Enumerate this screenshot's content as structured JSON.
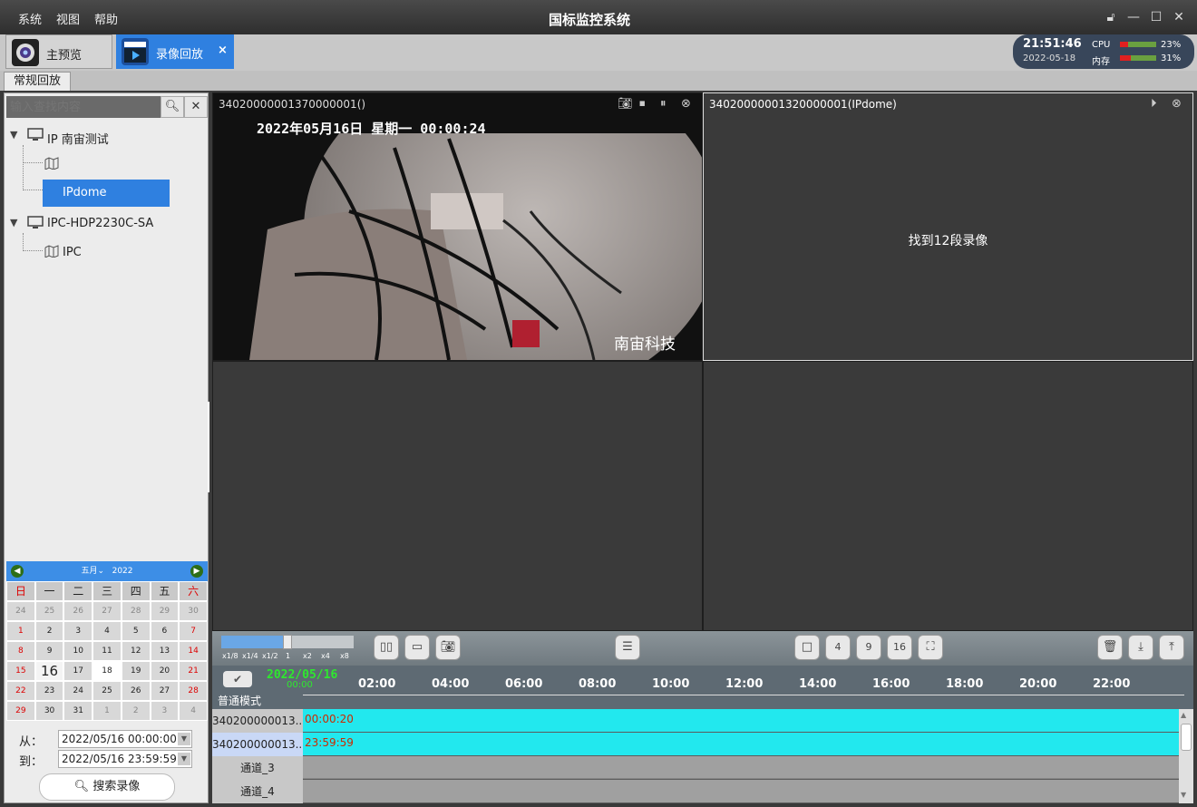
{
  "menu": [
    "系统",
    "视图",
    "帮助"
  ],
  "app_title": "国标监控系统",
  "app_tabs": [
    {
      "label": "主预览"
    },
    {
      "label": "录像回放",
      "close": "×"
    }
  ],
  "sysinfo": {
    "time": "21:51:46",
    "date": "2022-05-18",
    "cpu_label": "CPU",
    "cpu_value": "23%",
    "cpu_level": 0.23,
    "mem_label": "内存",
    "mem_value": "31%",
    "mem_level": 0.31
  },
  "subtab": "常规回放",
  "search": {
    "placeholder": "输入查找内容"
  },
  "tree": {
    "group1": "IP 南宙测试",
    "item1a": "",
    "item1b": "IPdome",
    "group2": "IPC-HDP2230C-SA",
    "item2a": "IPC"
  },
  "calendar": {
    "month": "五月",
    "year": "2022",
    "weekdays": [
      "日",
      "一",
      "二",
      "三",
      "四",
      "五",
      "六"
    ],
    "days": [
      "24",
      "25",
      "26",
      "27",
      "28",
      "29",
      "30",
      "1",
      "2",
      "3",
      "4",
      "5",
      "6",
      "7",
      "8",
      "9",
      "10",
      "11",
      "12",
      "13",
      "14",
      "15",
      "16",
      "17",
      "18",
      "19",
      "20",
      "21",
      "22",
      "23",
      "24",
      "25",
      "26",
      "27",
      "28",
      "29",
      "30",
      "31",
      "1",
      "2",
      "3",
      "4"
    ],
    "selected": "16",
    "today": "18"
  },
  "range": {
    "from_label": "从：",
    "from_value": "2022/05/16 00:00:00",
    "to_label": "到：",
    "to_value": "2022/05/16 23:59:59"
  },
  "search_record_button": "搜索录像",
  "videos": [
    {
      "title": "34020000001370000001()",
      "osd_time": "2022年05月16日  星期一  00:00:24",
      "watermark": "南宙科技"
    },
    {
      "title": "34020000001320000001(IPdome)",
      "message": "找到12段录像"
    }
  ],
  "speed": {
    "labels": [
      "x1/8",
      "x1/4",
      "x1/2",
      "1",
      "x2",
      "x4",
      "x8"
    ],
    "level": 0.5
  },
  "timeline": {
    "date": "2022/05/16",
    "start": "00:00",
    "ticks": [
      "02:00",
      "04:00",
      "06:00",
      "08:00",
      "10:00",
      "12:00",
      "14:00",
      "16:00",
      "18:00",
      "20:00",
      "22:00"
    ],
    "mode": "普通模式",
    "rows": [
      {
        "name": "340200000013...",
        "time": "00:00:20"
      },
      {
        "name": "340200000013...",
        "time": "23:59:59"
      },
      {
        "name": "通道_3"
      },
      {
        "name": "通道_4"
      }
    ]
  },
  "colors": {
    "accent": "#2f80e0",
    "record_bar": "#22e8ee",
    "osd_red": "#cc2a00"
  }
}
